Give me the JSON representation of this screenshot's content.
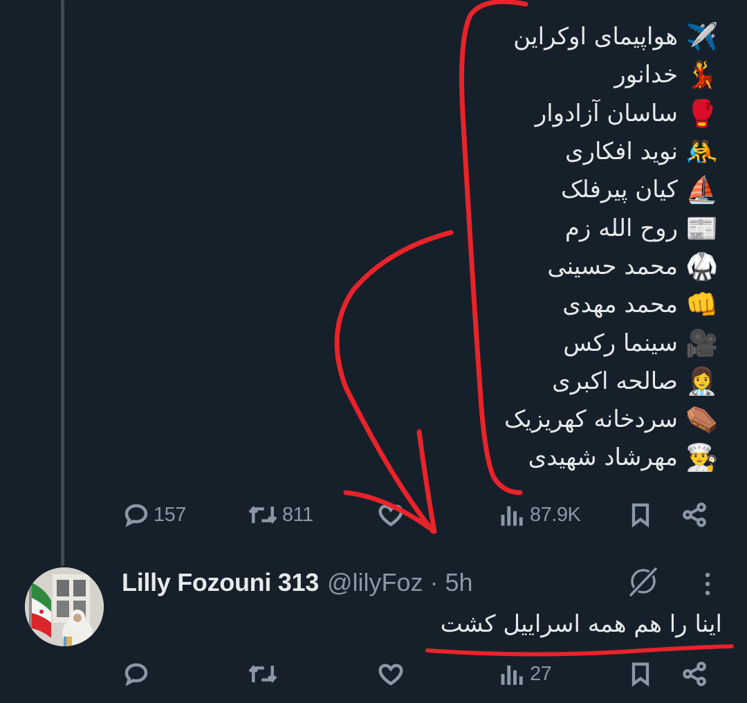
{
  "first_tweet": {
    "list": [
      {
        "emoji": "✈️",
        "text": "هواپیمای اوکراین"
      },
      {
        "emoji": "💃",
        "text": "خدانور"
      },
      {
        "emoji": "🥊",
        "text": "ساسان آزادوار"
      },
      {
        "emoji": "🤼",
        "text": "نوید افکاری"
      },
      {
        "emoji": "⛵",
        "text": "کیان پیرفلک"
      },
      {
        "emoji": "📰",
        "text": "روح الله زم"
      },
      {
        "emoji": "🥋",
        "text": "محمد حسینی"
      },
      {
        "emoji": "👊",
        "text": "محمد مهدی"
      },
      {
        "emoji": "🎥",
        "text": "سینما رکس"
      },
      {
        "emoji": "👩‍⚕️",
        "text": "صالحه اکبری"
      },
      {
        "emoji": "⚰️",
        "text": "سردخانه کهریزیک"
      },
      {
        "emoji": "👨‍🍳",
        "text": "مهرشاد شهیدی"
      }
    ],
    "actions": {
      "replies": "157",
      "retweets": "811",
      "likes": "",
      "views": "87.9K"
    }
  },
  "reply_tweet": {
    "name": "Lilly Fozouni 313",
    "handle": "@lilyFoz · 5h",
    "text": "اینا را هم همه اسراییل کشت",
    "actions": {
      "replies": "",
      "retweets": "",
      "likes": "",
      "views": "27"
    }
  },
  "colors": {
    "background": "#15202b",
    "text": "#e7e9ea",
    "muted": "#8b98a5",
    "annotation": "#e8232a"
  },
  "icons": [
    "reply-icon",
    "retweet-icon",
    "like-icon",
    "views-icon",
    "bookmark-icon",
    "share-icon",
    "grok-icon",
    "more-icon"
  ]
}
